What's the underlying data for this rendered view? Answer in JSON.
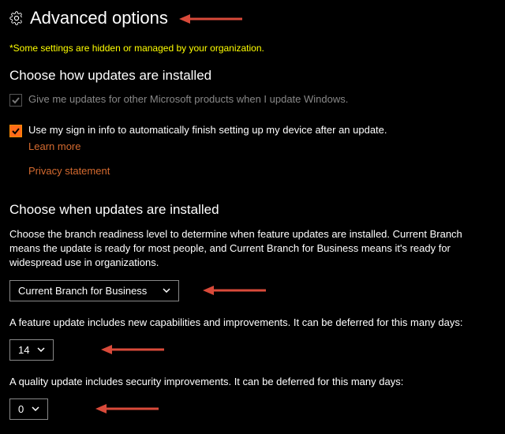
{
  "header": {
    "title": "Advanced options",
    "icon": "gear-icon"
  },
  "warning": "*Some settings are hidden or managed by your organization.",
  "section_install_how": {
    "title": "Choose how updates are installed",
    "checkbox_ms_products": {
      "label": "Give me updates for other Microsoft products when I update Windows.",
      "checked": true,
      "disabled": true
    },
    "checkbox_signin": {
      "label": "Use my sign in info to automatically finish setting up my device after an update.",
      "checked": true,
      "disabled": false,
      "learn_more": "Learn more"
    },
    "privacy_link": "Privacy statement"
  },
  "section_install_when": {
    "title": "Choose when updates are installed",
    "branch_desc": "Choose the branch readiness level to determine when feature updates are installed. Current Branch means the update is ready for most people, and Current Branch for Business means it's ready for widespread use in organizations.",
    "branch_dropdown": {
      "value": "Current Branch for Business"
    },
    "feature_desc": "A feature update includes new capabilities and improvements. It can be deferred for this many days:",
    "feature_dropdown": {
      "value": "14"
    },
    "quality_desc": "A quality update includes security improvements. It can be deferred for this many days:",
    "quality_dropdown": {
      "value": "0"
    }
  },
  "colors": {
    "annotation_arrow": "#d94a3a"
  }
}
